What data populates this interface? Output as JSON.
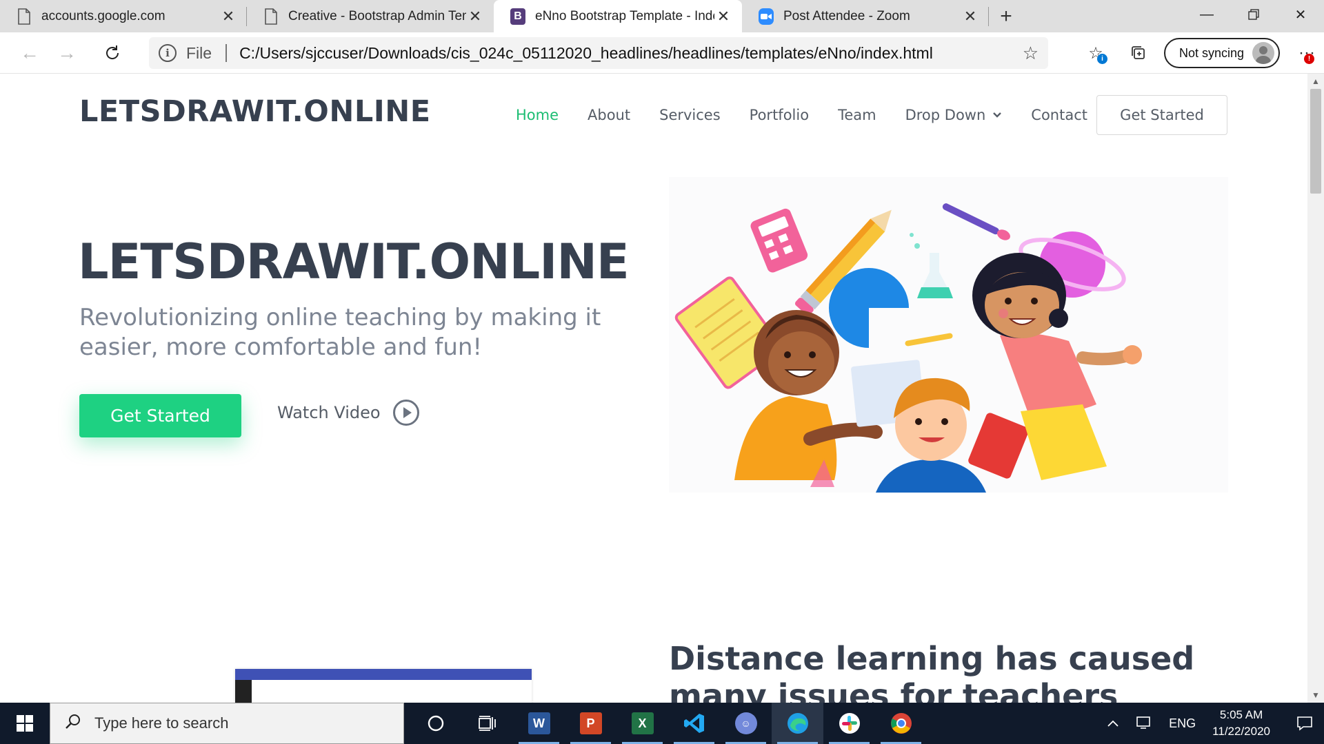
{
  "browser": {
    "tabs": [
      {
        "title": "accounts.google.com",
        "active": false
      },
      {
        "title": "Creative - Bootstrap Admin Templ",
        "active": false
      },
      {
        "title": "eNno Bootstrap Template - Index",
        "active": true
      },
      {
        "title": "Post Attendee - Zoom",
        "active": false
      }
    ],
    "omnibox": {
      "scheme_label": "File",
      "url": "C:/Users/sjccuser/Downloads/cis_024c_05112020_headlines/headlines/templates/eNno/index.html"
    },
    "sync_label": "Not syncing"
  },
  "site": {
    "logo": "LETSDRAWIT.ONLINE",
    "nav": [
      {
        "label": "Home",
        "active": true
      },
      {
        "label": "About",
        "active": false
      },
      {
        "label": "Services",
        "active": false
      },
      {
        "label": "Portfolio",
        "active": false
      },
      {
        "label": "Team",
        "active": false
      },
      {
        "label": "Drop Down",
        "active": false,
        "dropdown": true
      },
      {
        "label": "Contact",
        "active": false
      }
    ],
    "nav_cta": "Get Started",
    "hero": {
      "title": "LETSDRAWIT.ONLINE",
      "subtitle": "Revolutionizing online teaching by making it easier, more comfortable and fun!",
      "cta": "Get Started",
      "watch_video": "Watch Video"
    },
    "section_title": "Distance learning has caused many issues for teachers"
  },
  "taskbar": {
    "search_placeholder": "Type here to search",
    "language": "ENG",
    "time": "5:05 AM",
    "date": "11/22/2020"
  },
  "colors": {
    "accent": "#1ed182",
    "nav_active": "#1bbd72",
    "heading": "#37404f",
    "taskbar": "#101a2b"
  }
}
